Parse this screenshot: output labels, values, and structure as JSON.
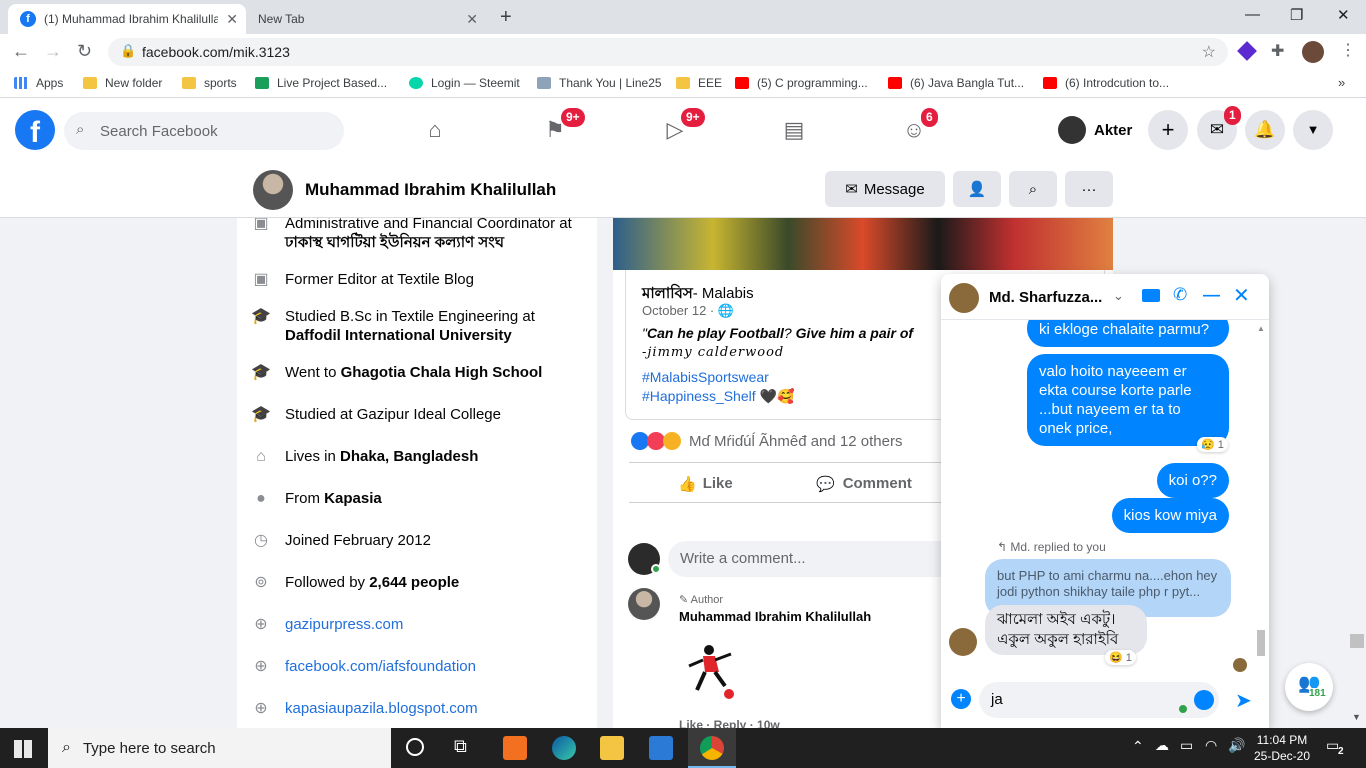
{
  "browser": {
    "tabs": [
      {
        "title": "(1) Muhammad Ibrahim Khalilulla",
        "active": true
      },
      {
        "title": "New Tab",
        "active": false
      }
    ],
    "url": "facebook.com/mik.3123",
    "bookmarks": [
      "Apps",
      "New folder",
      "sports",
      "Live Project Based...",
      "Login — Steemit",
      "Thank You | Line25",
      "EEE",
      "(5) C programming...",
      "(6) Java Bangla Tut...",
      "(6) Introdcution to..."
    ]
  },
  "fb_header": {
    "search_placeholder": "Search Facebook",
    "badges": {
      "pages": "9+",
      "watch": "9+",
      "groups": "6",
      "messenger": "1"
    },
    "user_name": "Akter"
  },
  "profile": {
    "name": "Muhammad Ibrahim Khalilullah",
    "message_label": "Message"
  },
  "intro": {
    "work1_prefix": "Administrative and Financial Coordinator at",
    "work1_org": "ঢাকাস্থ ঘাগটিয়া ইউনিয়ন কল্যাণ সংঘ",
    "work2_prefix": "Former Editor at ",
    "work2_org": "Textile Blog",
    "edu1_prefix": "Studied B.Sc in Textile Engineering at",
    "edu1_org": "Daffodil International University",
    "edu2_prefix": "Went to ",
    "edu2_org": "Ghagotia Chala High School",
    "edu3": "Studied at Gazipur Ideal College",
    "lives_prefix": "Lives in ",
    "lives_place": "Dhaka, Bangladesh",
    "from_prefix": "From ",
    "from_place": "Kapasia",
    "joined": "Joined February 2012",
    "followed_prefix": "Followed by ",
    "followed_count": "2,644 people",
    "links": [
      "gazipurpress.com",
      "facebook.com/iafsfoundation",
      "kapasiaupazila.blogspot.com"
    ]
  },
  "post": {
    "shared_page": "মালাবিস",
    "shared_page_en": "- Malabis",
    "date": "October 12 · ",
    "quote_open": "\"",
    "quote_b1": "Can he play Football",
    "quote_q": "? ",
    "quote_b2": "Give him a pair of",
    "quote_author": "-jimmy calderwood",
    "hashtag1": "#MalabisSportswear",
    "hashtag2": "#Happiness_Shelf",
    "reactions_text": "Mɗ Mŕiɗúĺ Ãhmêđ and 12 others",
    "like_label": "Like",
    "comment_label": "Comment",
    "comment_placeholder": "Write a comment...",
    "author_tag": "Author",
    "comment_author": "Muhammad Ibrahim Khalilullah",
    "comment_actions": "Like · Reply · 10w"
  },
  "chat": {
    "contact": "Md. Sharfuzza...",
    "messages": [
      {
        "text": "ki  ekloge chalaite parmu?",
        "from": "me"
      },
      {
        "text": "valo hoito nayeeem er ekta course korte parle ...but nayeem er ta to onek price,",
        "from": "me",
        "reaction": "😥",
        "reaction_count": "1"
      },
      {
        "text": "koi o??",
        "from": "me"
      },
      {
        "text": "kios kow miya",
        "from": "me"
      }
    ],
    "reply_label": "Md. replied to you",
    "quoted": "but PHP to ami charmu na....ehon hey jodi python shikhay taile php r pyt...",
    "incoming": "ঝামেলা অইব একটু।\nএকুল অকুল হারাইবি",
    "incoming_reaction": "😆",
    "incoming_reaction_count": "1",
    "input_value": "ja"
  },
  "fab_count": "181",
  "taskbar": {
    "search_placeholder": "Type here to search",
    "time": "11:04 PM",
    "date": "25-Dec-20",
    "notif_count": "2"
  },
  "colors": {
    "fb_blue": "#1877f2",
    "messenger_blue": "#0084ff",
    "badge_red": "#e41e3f",
    "link": "#216fdb"
  }
}
